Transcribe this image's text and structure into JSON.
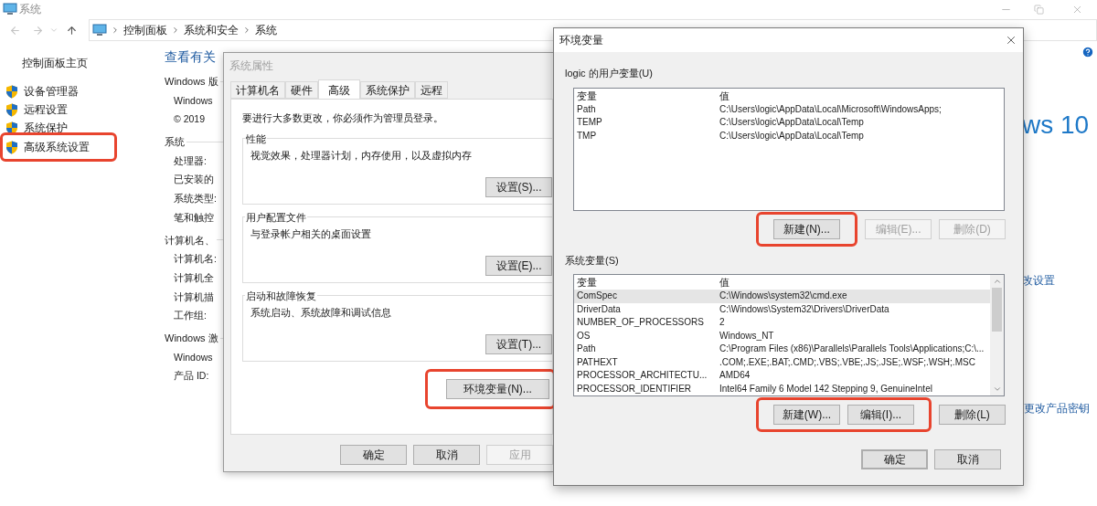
{
  "window": {
    "title": "系统",
    "breadcrumb": [
      "控制面板",
      "系统和安全",
      "系统"
    ]
  },
  "sidebar": {
    "home": "控制面板主页",
    "items": [
      {
        "label": "设备管理器",
        "highlighted": false
      },
      {
        "label": "远程设置",
        "highlighted": false
      },
      {
        "label": "系统保护",
        "highlighted": false
      },
      {
        "label": "高级系统设置",
        "highlighted": true
      }
    ]
  },
  "main": {
    "heading": "查看有关",
    "sections": [
      {
        "title": "Windows 版",
        "rows": [
          "Windows",
          "© 2019"
        ]
      },
      {
        "title": "系统",
        "rows": [
          "处理器:",
          "已安装的",
          "系统类型:",
          "笔和触控"
        ]
      },
      {
        "title": "计算机名、",
        "rows": [
          "计算机名:",
          "计算机全",
          "计算机描",
          "工作组:"
        ]
      },
      {
        "title": "Windows 激",
        "rows": [
          "Windows",
          "产品 ID:"
        ]
      }
    ]
  },
  "right": {
    "logo": "ws 10",
    "links": [
      "改设置",
      "更改产品密钥"
    ]
  },
  "system_properties": {
    "title": "系统属性",
    "tabs": [
      {
        "label": "计算机名",
        "selected": false
      },
      {
        "label": "硬件",
        "selected": false
      },
      {
        "label": "高级",
        "selected": true
      },
      {
        "label": "系统保护",
        "selected": false
      },
      {
        "label": "远程",
        "selected": false
      }
    ],
    "notice": "要进行大多数更改，你必须作为管理员登录。",
    "groups": [
      {
        "title": "性能",
        "description": "视觉效果，处理器计划，内存使用，以及虚拟内存",
        "button": "设置(S)..."
      },
      {
        "title": "用户配置文件",
        "description": "与登录帐户相关的桌面设置",
        "button": "设置(E)..."
      },
      {
        "title": "启动和故障恢复",
        "description": "系统启动、系统故障和调试信息",
        "button": "设置(T)..."
      }
    ],
    "env_button": {
      "label": "环境变量(N)...",
      "highlighted": true
    },
    "buttons": [
      {
        "label": "确定",
        "disabled": false
      },
      {
        "label": "取消",
        "disabled": false
      },
      {
        "label": "应用",
        "disabled": true
      }
    ]
  },
  "environment_variables": {
    "title": "环境变量",
    "user_vars": {
      "title": "logic 的用户变量(U)",
      "columns": [
        "变量",
        "值"
      ],
      "rows": [
        {
          "name": "Path",
          "value": "C:\\Users\\logic\\AppData\\Local\\Microsoft\\WindowsApps;",
          "selected": false
        },
        {
          "name": "TEMP",
          "value": "C:\\Users\\logic\\AppData\\Local\\Temp",
          "selected": false
        },
        {
          "name": "TMP",
          "value": "C:\\Users\\logic\\AppData\\Local\\Temp",
          "selected": false
        }
      ],
      "buttons": [
        {
          "label": "新建(N)...",
          "disabled": false,
          "highlighted": true
        },
        {
          "label": "编辑(E)...",
          "disabled": true,
          "highlighted": false
        },
        {
          "label": "删除(D)",
          "disabled": true,
          "highlighted": false
        }
      ]
    },
    "system_vars": {
      "title": "系统变量(S)",
      "columns": [
        "变量",
        "值"
      ],
      "rows": [
        {
          "name": "ComSpec",
          "value": "C:\\Windows\\system32\\cmd.exe",
          "selected": true
        },
        {
          "name": "DriverData",
          "value": "C:\\Windows\\System32\\Drivers\\DriverData",
          "selected": false
        },
        {
          "name": "NUMBER_OF_PROCESSORS",
          "value": "2",
          "selected": false
        },
        {
          "name": "OS",
          "value": "Windows_NT",
          "selected": false
        },
        {
          "name": "Path",
          "value": "C:\\Program Files (x86)\\Parallels\\Parallels Tools\\Applications;C:\\...",
          "selected": false
        },
        {
          "name": "PATHEXT",
          "value": ".COM;.EXE;.BAT;.CMD;.VBS;.VBE;.JS;.JSE;.WSF;.WSH;.MSC",
          "selected": false
        },
        {
          "name": "PROCESSOR_ARCHITECTU...",
          "value": "AMD64",
          "selected": false
        },
        {
          "name": "PROCESSOR_IDENTIFIER",
          "value": "Intel64 Family 6 Model 142 Stepping 9, GenuineIntel",
          "selected": false
        }
      ],
      "buttons": [
        {
          "label": "新建(W)...",
          "disabled": false,
          "highlighted": true
        },
        {
          "label": "编辑(I)...",
          "disabled": false,
          "highlighted": true
        },
        {
          "label": "删除(L)",
          "disabled": false,
          "highlighted": false
        }
      ]
    },
    "buttons": [
      {
        "label": "确定",
        "default": true
      },
      {
        "label": "取消",
        "default": false
      }
    ]
  }
}
